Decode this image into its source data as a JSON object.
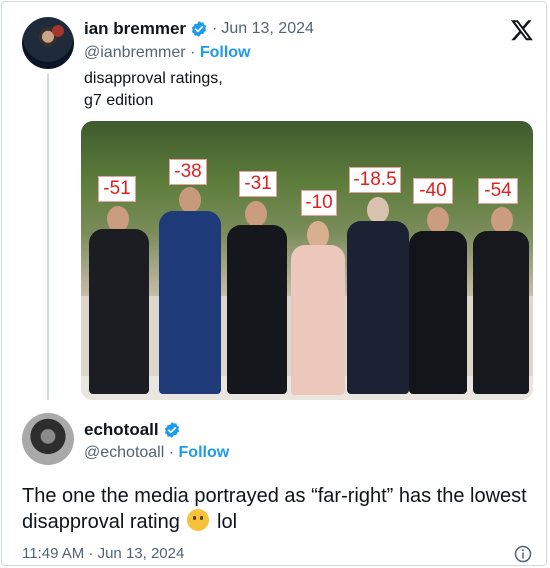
{
  "original_tweet": {
    "display_name": "ian bremmer",
    "date": "Jun 13, 2024",
    "handle": "@ianbremmer",
    "follow_label": "Follow",
    "text_line1": "disapproval ratings,",
    "text_line2": "g7 edition",
    "image_labels": [
      "-51",
      "-38",
      "-31",
      "-10",
      "-18.5",
      "-40",
      "-54"
    ]
  },
  "reply_tweet": {
    "display_name": "echotoall",
    "handle": "@echotoall",
    "follow_label": "Follow",
    "text_before": "The one the media portrayed as “far-right” has the lowest disapproval rating",
    "text_after": "lol",
    "timestamp": "11:49 AM · Jun 13, 2024"
  },
  "colors": {
    "follow_blue": "#1d9bf0",
    "verified_blue": "#1d9bf0",
    "secondary_text": "#536471",
    "label_red": "#e0201e"
  },
  "icons": {
    "verified": "verified-badge-icon",
    "x_logo": "x-logo-icon",
    "info": "info-icon",
    "emoji": "thinking-face-emoji"
  }
}
